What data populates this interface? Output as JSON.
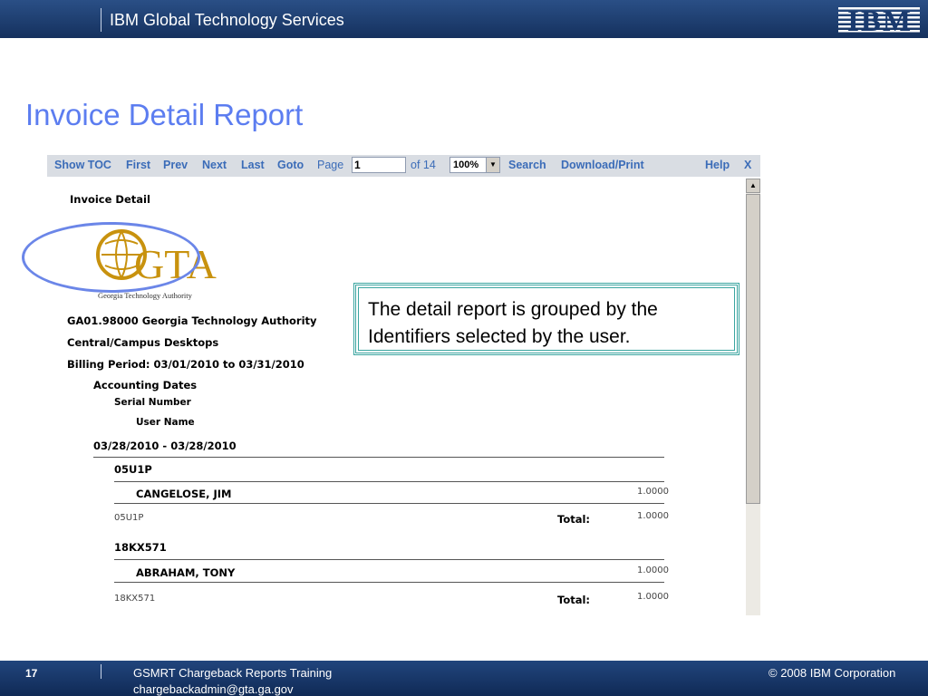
{
  "header": {
    "brand": "IBM Global Technology Services",
    "logo_text": "IBM"
  },
  "title": "Invoice Detail Report",
  "toolbar": {
    "show_toc": "Show TOC",
    "first": "First",
    "prev": "Prev",
    "next": "Next",
    "last": "Last",
    "goto": "Goto",
    "page_label": "Page",
    "page_value": "1",
    "of_pages": "of 14",
    "zoom": "100%",
    "search": "Search",
    "download_print": "Download/Print",
    "help": "Help",
    "close": "X"
  },
  "report": {
    "heading": "Invoice Detail",
    "logo_main": "GTA",
    "logo_sub": "Georgia Technology Authority",
    "org": "GA01.98000 Georgia Technology Authority",
    "group": "Central/Campus Desktops",
    "billing": "Billing Period: 03/01/2010 to 03/31/2010",
    "identifiers": [
      "Accounting Dates",
      "Serial Number",
      "User Name"
    ],
    "date_range": "03/28/2010 - 03/28/2010",
    "serials": [
      {
        "serial": "05U1P",
        "user": "CANGELOSE, JIM",
        "user_value": "1.0000",
        "footer_serial": "05U1P",
        "total_label": "Total:",
        "total_value": "1.0000"
      },
      {
        "serial": "18KX571",
        "user": "ABRAHAM, TONY",
        "user_value": "1.0000",
        "footer_serial": "18KX571",
        "total_label": "Total:",
        "total_value": "1.0000"
      }
    ]
  },
  "callout": "The detail report is grouped by the Identifiers selected by the user.",
  "footer": {
    "slide_number": "17",
    "course": "GSMRT Chargeback Reports Training",
    "email": "chargebackadmin@gta.ga.gov",
    "copyright": "© 2008 IBM Corporation"
  },
  "colors": {
    "title": "#5c7df0",
    "banner": "#1f427a",
    "link": "#3b6cb8",
    "gta_gold": "#c8920e",
    "callout_border": "#3aa5a0",
    "circle": "#6b86e8"
  }
}
